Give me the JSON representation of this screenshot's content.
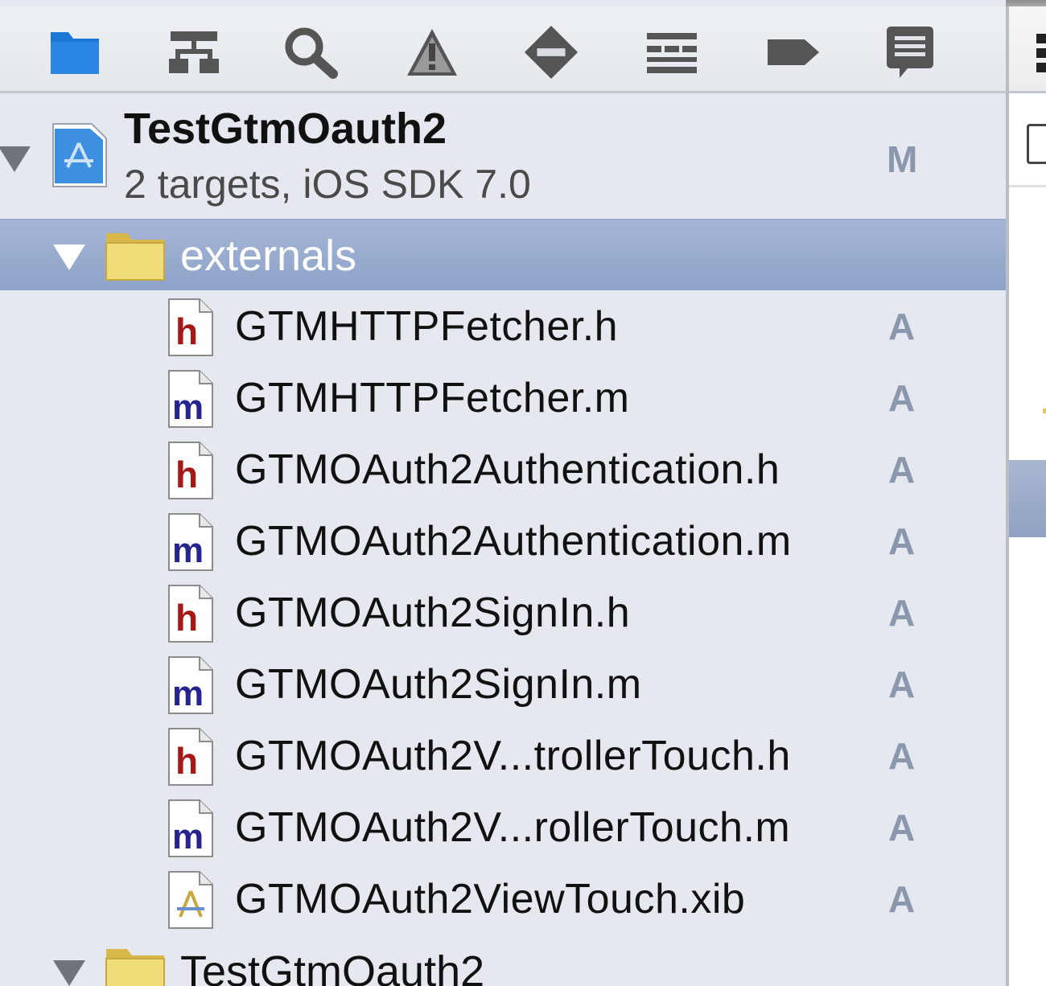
{
  "toolbar": {
    "icons": [
      {
        "name": "project-navigator-icon",
        "label": ""
      },
      {
        "name": "symbol-navigator-icon",
        "label": ""
      },
      {
        "name": "find-navigator-icon",
        "label": ""
      },
      {
        "name": "issue-navigator-icon",
        "label": ""
      },
      {
        "name": "test-navigator-icon",
        "label": ""
      },
      {
        "name": "debug-navigator-icon",
        "label": ""
      },
      {
        "name": "breakpoint-navigator-icon",
        "label": ""
      },
      {
        "name": "log-navigator-icon",
        "label": ""
      }
    ]
  },
  "project": {
    "name": "TestGtmOauth2",
    "subtitle": "2 targets, iOS SDK 7.0",
    "status": "M"
  },
  "groups": [
    {
      "name": "externals",
      "selected": true,
      "files": [
        {
          "name": "GTMHTTPFetcher.h",
          "type": "h",
          "status": "A"
        },
        {
          "name": "GTMHTTPFetcher.m",
          "type": "m",
          "status": "A"
        },
        {
          "name": "GTMOAuth2Authentication.h",
          "type": "h",
          "status": "A"
        },
        {
          "name": "GTMOAuth2Authentication.m",
          "type": "m",
          "status": "A"
        },
        {
          "name": "GTMOAuth2SignIn.h",
          "type": "h",
          "status": "A"
        },
        {
          "name": "GTMOAuth2SignIn.m",
          "type": "m",
          "status": "A"
        },
        {
          "name": "GTMOAuth2V...trollerTouch.h",
          "type": "h",
          "status": "A"
        },
        {
          "name": "GTMOAuth2V...rollerTouch.m",
          "type": "m",
          "status": "A"
        },
        {
          "name": "GTMOAuth2ViewTouch.xib",
          "type": "xib",
          "status": "A"
        }
      ]
    },
    {
      "name": "TestGtmOauth2",
      "selected": false,
      "files": []
    }
  ],
  "colors": {
    "selection": "#97aacd",
    "header_letter": "#a51818",
    "impl_letter": "#26248f",
    "status_letter": "#8a97ac",
    "folder": "#efd56a"
  }
}
